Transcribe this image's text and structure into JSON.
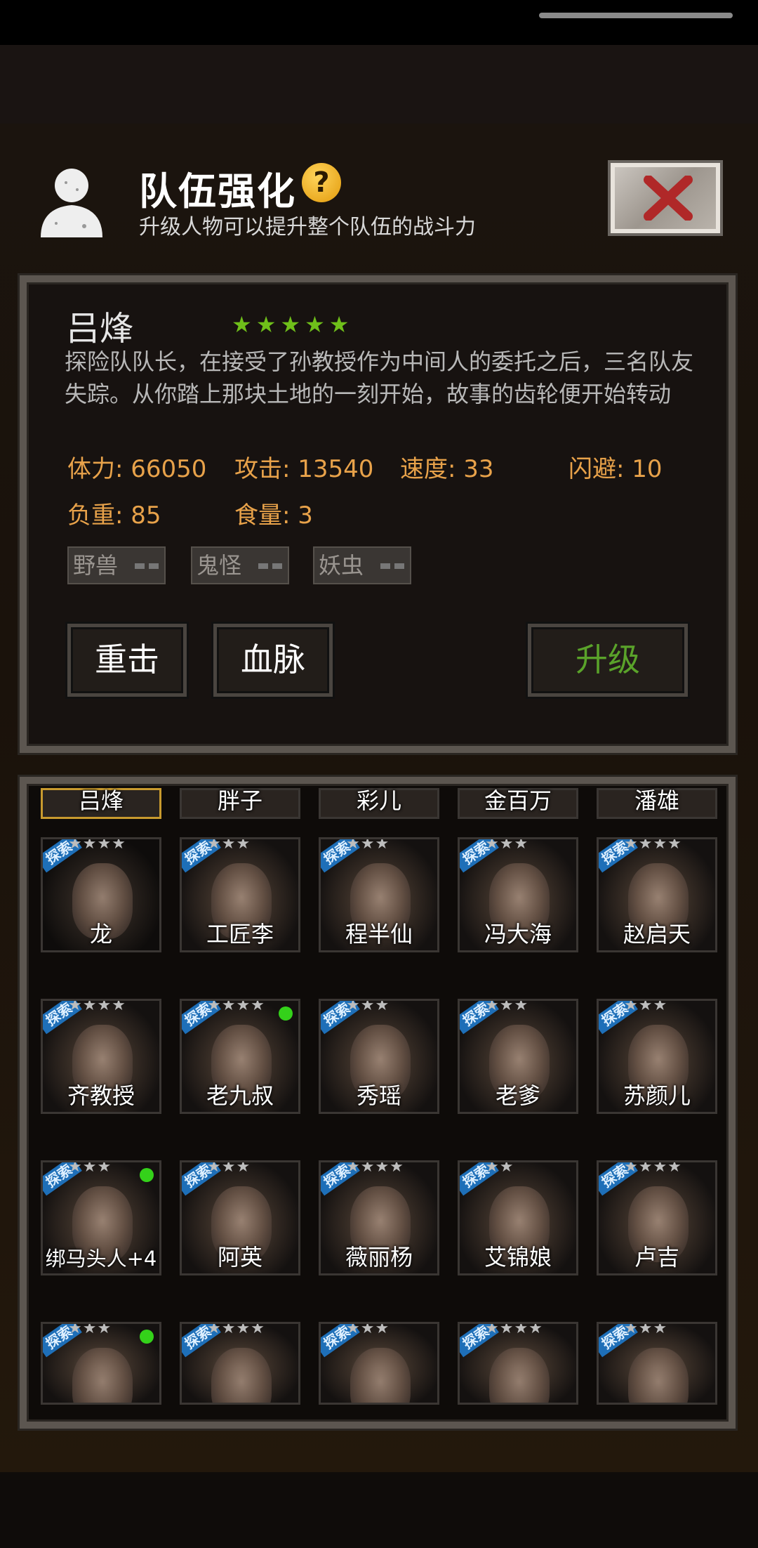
{
  "header": {
    "title": "队伍强化",
    "help_icon": "?",
    "subtitle": "升级人物可以提升整个队伍的战斗力"
  },
  "character": {
    "name": "吕烽",
    "stars": 5,
    "description": "探险队队长，在接受了孙教授作为中间人的委托之后，三名队友失踪。从你踏上那块土地的一刻开始，故事的齿轮便开始转动",
    "stats": [
      {
        "label": "体力: 66050"
      },
      {
        "label": "攻击: 13540"
      },
      {
        "label": "速度: 33"
      },
      {
        "label": "闪避: 10"
      },
      {
        "label": "负重: 85"
      },
      {
        "label": "食量: 3"
      }
    ],
    "tags": [
      "野兽",
      "鬼怪",
      "妖虫"
    ],
    "skills": [
      "重击",
      "血脉"
    ],
    "upgrade_label": "升级"
  },
  "roster": {
    "badge_label": "探索",
    "top_row": [
      "吕烽",
      "胖子",
      "彩儿",
      "金百万",
      "潘雄"
    ],
    "rows": [
      [
        "龙",
        "工匠李",
        "程半仙",
        "冯大海",
        "赵启天"
      ],
      [
        "齐教授",
        "老九叔",
        "秀瑶",
        "老爹",
        "苏颜儿"
      ],
      [
        "绑马头人+4",
        "阿英",
        "薇丽杨",
        "艾锦娘",
        "卢吉"
      ]
    ]
  },
  "colors": {
    "stat_orange": "#e8a24a",
    "star_green": "#6fbf1a",
    "upgrade_green": "#5aa32a",
    "badge_blue": "#1e6fb8",
    "close_red": "#b02828"
  }
}
